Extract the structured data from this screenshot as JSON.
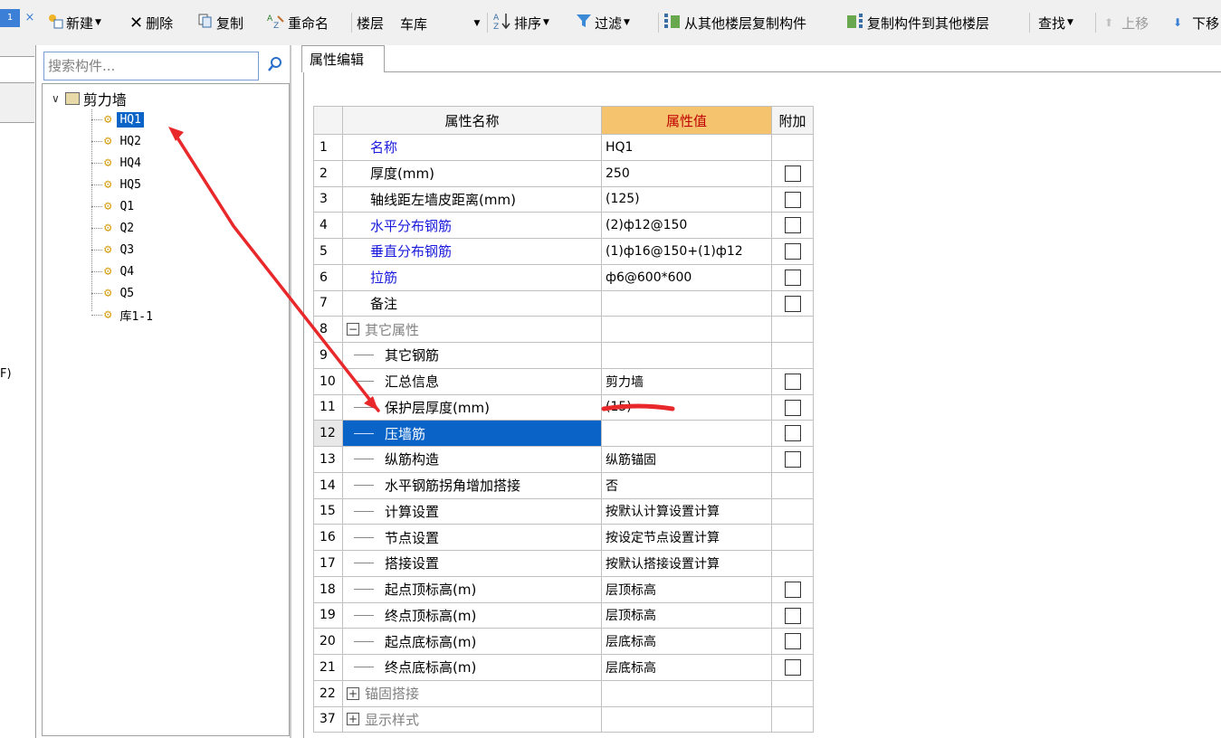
{
  "toolbar": {
    "tab_stub_label": "1",
    "tab_close": "×",
    "new_label": "新建",
    "delete_label": "删除",
    "copy_label": "复制",
    "rename_label": "重命名",
    "floor_label": "楼层",
    "floor_value": "车库",
    "sort_label": "排序",
    "filter_label": "过滤",
    "copy_from_floor_label": "从其他楼层复制构件",
    "copy_to_floor_label": "复制构件到其他楼层",
    "find_label": "查找",
    "move_up_label": "上移",
    "move_down_label": "下移"
  },
  "left_stub": {
    "cut_text": "F)"
  },
  "search": {
    "placeholder": "搜索构件..."
  },
  "tree": {
    "root_label": "剪力墙",
    "items": [
      {
        "label": "HQ1",
        "selected": true
      },
      {
        "label": "HQ2"
      },
      {
        "label": "HQ4"
      },
      {
        "label": "HQ5"
      },
      {
        "label": "Q1"
      },
      {
        "label": "Q2"
      },
      {
        "label": "Q3"
      },
      {
        "label": "Q4"
      },
      {
        "label": "Q5"
      },
      {
        "label": "库1-1"
      }
    ]
  },
  "property_panel": {
    "tab_label": "属性编辑",
    "columns": {
      "name": "属性名称",
      "value": "属性值",
      "extra": "附加"
    },
    "rows": [
      {
        "num": "1",
        "name": "名称",
        "value": "HQ1",
        "kind": "blue",
        "checkbox": false
      },
      {
        "num": "2",
        "name": "厚度(mm)",
        "value": "250",
        "kind": "black",
        "checkbox": true
      },
      {
        "num": "3",
        "name": "轴线距左墙皮距离(mm)",
        "value": "(125)",
        "kind": "black",
        "checkbox": true
      },
      {
        "num": "4",
        "name": "水平分布钢筋",
        "value": "(2)ф12@150",
        "kind": "blue",
        "checkbox": true
      },
      {
        "num": "5",
        "name": "垂直分布钢筋",
        "value": "(1)ф16@150+(1)ф12",
        "kind": "blue",
        "checkbox": true
      },
      {
        "num": "6",
        "name": "拉筋",
        "value": "ф6@600*600",
        "kind": "blue",
        "checkbox": true
      },
      {
        "num": "7",
        "name": "备注",
        "value": "",
        "kind": "black",
        "checkbox": true
      },
      {
        "num": "8",
        "name": "其它属性",
        "value": "",
        "kind": "group",
        "expander": "−",
        "checkbox": false
      },
      {
        "num": "9",
        "name": "其它钢筋",
        "value": "",
        "kind": "child",
        "checkbox": false
      },
      {
        "num": "10",
        "name": "汇总信息",
        "value": "剪力墙",
        "kind": "child",
        "checkbox": true
      },
      {
        "num": "11",
        "name": "保护层厚度(mm)",
        "value": "(15)",
        "kind": "child",
        "checkbox": true
      },
      {
        "num": "12",
        "name": "压墙筋",
        "value": "",
        "kind": "child",
        "checkbox": true,
        "selected": true
      },
      {
        "num": "13",
        "name": "纵筋构造",
        "value": "纵筋锚固",
        "kind": "child",
        "checkbox": true
      },
      {
        "num": "14",
        "name": "水平钢筋拐角增加搭接",
        "value": "否",
        "kind": "child",
        "checkbox": false
      },
      {
        "num": "15",
        "name": "计算设置",
        "value": "按默认计算设置计算",
        "kind": "child",
        "checkbox": false
      },
      {
        "num": "16",
        "name": "节点设置",
        "value": "按设定节点设置计算",
        "kind": "child",
        "checkbox": false
      },
      {
        "num": "17",
        "name": "搭接设置",
        "value": "按默认搭接设置计算",
        "kind": "child",
        "checkbox": false
      },
      {
        "num": "18",
        "name": "起点顶标高(m)",
        "value": "层顶标高",
        "kind": "child",
        "checkbox": true
      },
      {
        "num": "19",
        "name": "终点顶标高(m)",
        "value": "层顶标高",
        "kind": "child",
        "checkbox": true
      },
      {
        "num": "20",
        "name": "起点底标高(m)",
        "value": "层底标高",
        "kind": "child",
        "checkbox": true
      },
      {
        "num": "21",
        "name": "终点底标高(m)",
        "value": "层底标高",
        "kind": "child",
        "checkbox": true
      },
      {
        "num": "22",
        "name": "锚固搭接",
        "value": "",
        "kind": "group",
        "expander": "+",
        "checkbox": false
      },
      {
        "num": "37",
        "name": "显示样式",
        "value": "",
        "kind": "group",
        "expander": "+",
        "checkbox": false
      }
    ]
  },
  "colors": {
    "selection_blue": "#0a64c8",
    "value_header_bg": "#f5c36d",
    "value_header_text": "#c00000",
    "blue_name_text": "#1a1adc",
    "annotation_red": "#e8282a"
  }
}
